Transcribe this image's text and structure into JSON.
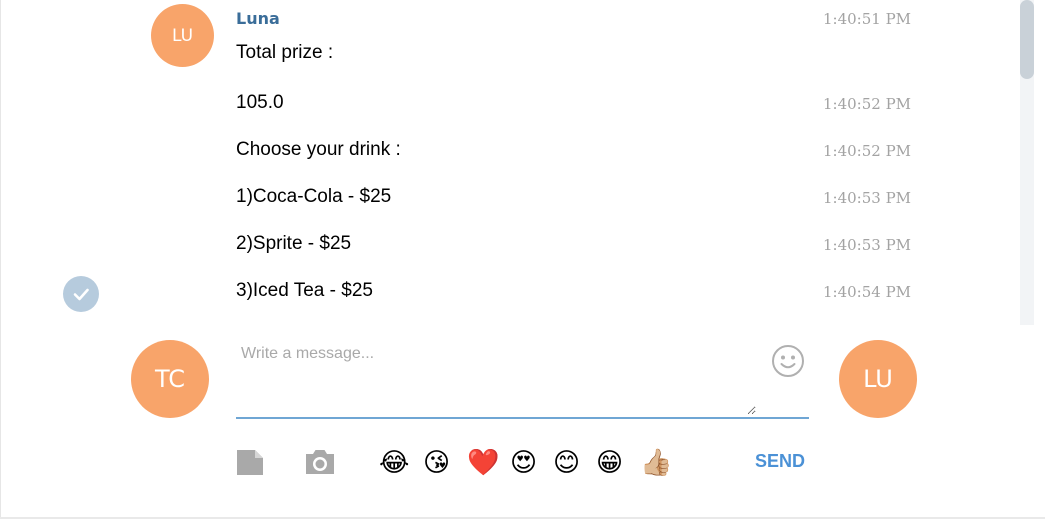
{
  "conversation": {
    "sender_name": "Luna",
    "sender_initials": "LU",
    "messages": [
      {
        "text": "Total prize :",
        "time": "1:40:51 PM"
      },
      {
        "text": "105.0",
        "time": "1:40:52 PM"
      },
      {
        "text": "Choose your drink :",
        "time": "1:40:52 PM"
      },
      {
        "text": "1)Coca-Cola - $25",
        "time": "1:40:53 PM"
      },
      {
        "text": "2)Sprite - $25",
        "time": "1:40:53 PM"
      },
      {
        "text": "3)Iced Tea - $25",
        "time": "1:40:54 PM"
      }
    ],
    "read_status_icon": "checkmark-icon"
  },
  "composer": {
    "placeholder": "Write a message...",
    "my_initials": "TC",
    "peer_initials": "LU",
    "emoji_picker_icon": "smiley-face-icon",
    "attach_icon": "document-icon",
    "camera_icon": "camera-icon",
    "quick_emojis": [
      "😂",
      "😘",
      "❤️",
      "😍",
      "😊",
      "😁",
      "👍🏼"
    ],
    "send_label": "SEND"
  },
  "colors": {
    "avatar": "#f8a46a",
    "sender_name": "#3a6d99",
    "send": "#4b91d6",
    "underline": "#6fa6d4"
  }
}
